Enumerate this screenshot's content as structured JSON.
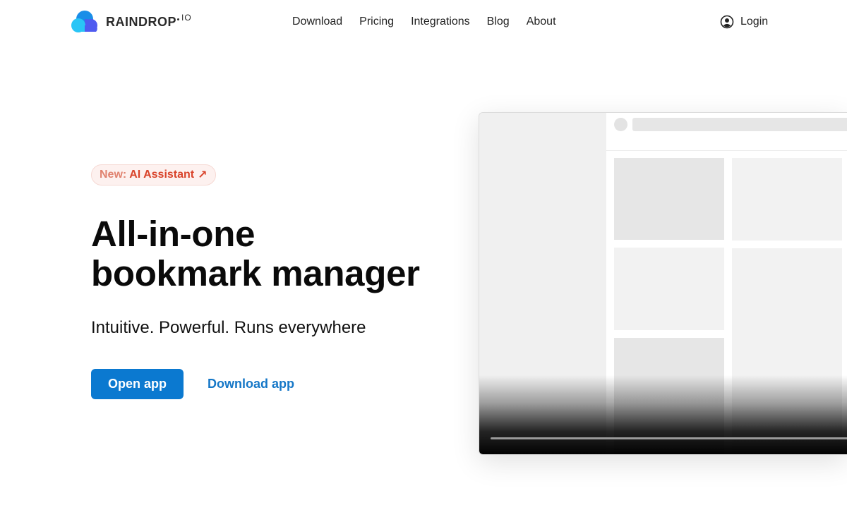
{
  "brand": {
    "name": "RAINDROP",
    "suffix": "IO",
    "colors": {
      "light_blue": "#29c5f6",
      "blue": "#1a8ee8",
      "violet": "#4f5bf0"
    }
  },
  "nav": {
    "links": [
      {
        "label": "Download"
      },
      {
        "label": "Pricing"
      },
      {
        "label": "Integrations"
      },
      {
        "label": "Blog"
      },
      {
        "label": "About"
      }
    ],
    "login": {
      "label": "Login",
      "icon": "user-circle-icon"
    }
  },
  "hero": {
    "badge": {
      "prefix": "New:",
      "title": "AI Assistant",
      "arrow": "↗"
    },
    "headline": [
      "All-in-one",
      "bookmark manager"
    ],
    "subheadline": "Intuitive. Powerful. Runs everywhere",
    "primary_cta": "Open app",
    "secondary_cta": "Download app",
    "colors": {
      "primary": "#0b79d0",
      "badge_text": "#d9432a",
      "badge_bg": "#fdf1ef"
    }
  },
  "preview": {
    "description_icon": "app-screenshot-placeholder"
  }
}
